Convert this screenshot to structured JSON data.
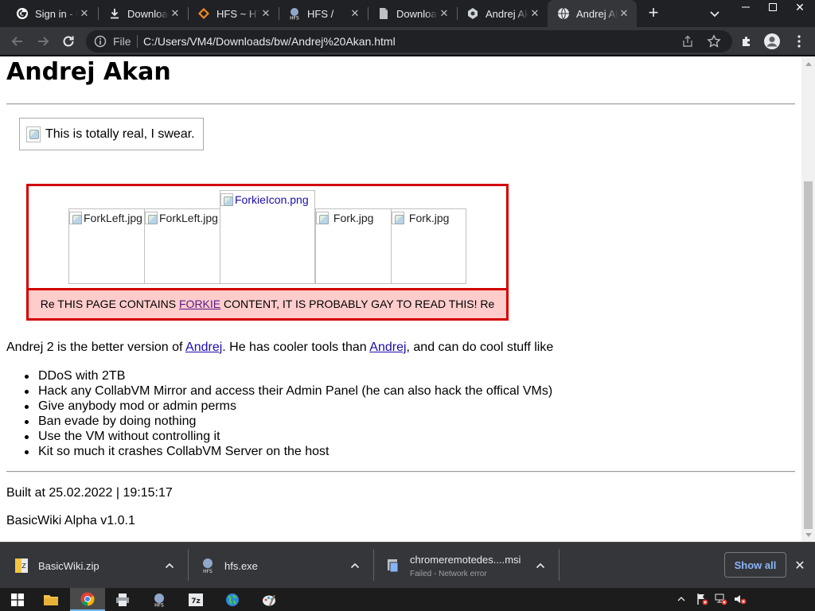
{
  "browser": {
    "tabs": [
      {
        "title": "Sign in - Google Accounts",
        "icon": "google-icon",
        "active": false
      },
      {
        "title": "Downloads",
        "icon": "download-icon",
        "active": false
      },
      {
        "title": "HFS ~ HTTP File Server",
        "icon": "hfs-icon",
        "active": false
      },
      {
        "title": "HFS /",
        "icon": "hfs-logo-icon",
        "active": false
      },
      {
        "title": "Downloads",
        "icon": "document-icon",
        "active": false
      },
      {
        "title": "Andrej Akan",
        "icon": "andrej-icon",
        "active": false
      },
      {
        "title": "Andrej Akan",
        "icon": "globe-icon",
        "active": true
      }
    ],
    "omnibox": {
      "scheme_label": "File",
      "url": "C:/Users/VM4/Downloads/bw/Andrej%20Akan.html"
    }
  },
  "page": {
    "title": "Andrej Akan",
    "note": {
      "text": "This is totally real, I swear."
    },
    "fork_images": [
      {
        "alt": "ForkLeft.jpg",
        "link": false
      },
      {
        "alt": "ForkLeft.jpg",
        "link": false
      },
      {
        "alt": "ForkieIcon.png",
        "link": true
      },
      {
        "alt": "Fork.jpg",
        "link": false
      },
      {
        "alt": "Fork.jpg",
        "link": false
      }
    ],
    "warning": {
      "prefix": "Re THIS PAGE CONTAINS ",
      "link": "FORKIE",
      "suffix": " CONTENT, IT IS PROBABLY GAY TO READ THIS! Re"
    },
    "intro": {
      "t1": "Andrej 2 is the better version of ",
      "link1": "Andrej",
      "t2": ". He has cooler tools than ",
      "link2": "Andrej",
      "t3": ", and can do cool stuff like"
    },
    "abilities": [
      "DDoS with 2TB",
      "Hack any CollabVM Mirror and access their Admin Panel (he can also hack the offical VMs)",
      "Give anybody mod or admin perms",
      "Ban evade by doing nothing",
      "Use the VM without controlling it",
      "Kit so much it crashes CollabVM Server on the host"
    ],
    "built": "Built at 25.02.2022 | 19:15:17",
    "version": "BasicWiki Alpha v1.0.1"
  },
  "downloads": {
    "items": [
      {
        "name": "BasicWiki.zip",
        "status": ""
      },
      {
        "name": "hfs.exe",
        "status": ""
      },
      {
        "name": "chromeremotedes....msi",
        "status": "Failed - Network error"
      }
    ],
    "show_all": "Show all"
  },
  "colors": {
    "accent_red": "#d40000",
    "warning_bg": "#ffcccc",
    "link": "#1a0dab",
    "visited": "#551a8b"
  }
}
